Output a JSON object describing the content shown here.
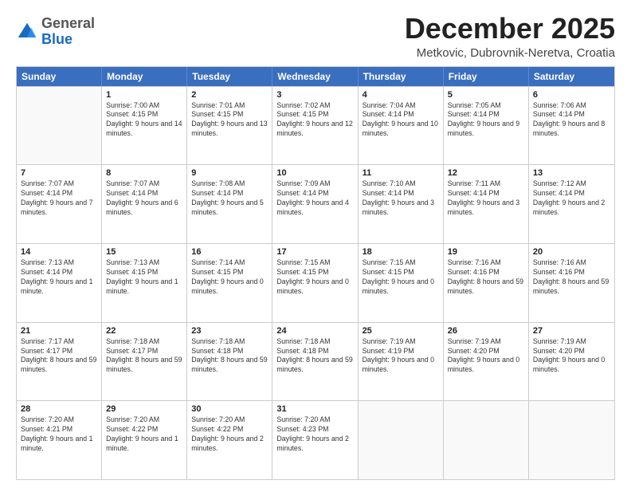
{
  "header": {
    "logo": {
      "general": "General",
      "blue": "Blue"
    },
    "month_title": "December 2025",
    "subtitle": "Metkovic, Dubrovnik-Neretva, Croatia"
  },
  "calendar": {
    "days_of_week": [
      "Sunday",
      "Monday",
      "Tuesday",
      "Wednesday",
      "Thursday",
      "Friday",
      "Saturday"
    ],
    "weeks": [
      [
        {
          "day": "",
          "empty": true
        },
        {
          "day": "1",
          "sunrise": "7:00 AM",
          "sunset": "4:15 PM",
          "daylight": "9 hours and 14 minutes."
        },
        {
          "day": "2",
          "sunrise": "7:01 AM",
          "sunset": "4:15 PM",
          "daylight": "9 hours and 13 minutes."
        },
        {
          "day": "3",
          "sunrise": "7:02 AM",
          "sunset": "4:15 PM",
          "daylight": "9 hours and 12 minutes."
        },
        {
          "day": "4",
          "sunrise": "7:04 AM",
          "sunset": "4:14 PM",
          "daylight": "9 hours and 10 minutes."
        },
        {
          "day": "5",
          "sunrise": "7:05 AM",
          "sunset": "4:14 PM",
          "daylight": "9 hours and 9 minutes."
        },
        {
          "day": "6",
          "sunrise": "7:06 AM",
          "sunset": "4:14 PM",
          "daylight": "9 hours and 8 minutes."
        }
      ],
      [
        {
          "day": "7",
          "sunrise": "7:07 AM",
          "sunset": "4:14 PM",
          "daylight": "9 hours and 7 minutes."
        },
        {
          "day": "8",
          "sunrise": "7:07 AM",
          "sunset": "4:14 PM",
          "daylight": "9 hours and 6 minutes."
        },
        {
          "day": "9",
          "sunrise": "7:08 AM",
          "sunset": "4:14 PM",
          "daylight": "9 hours and 5 minutes."
        },
        {
          "day": "10",
          "sunrise": "7:09 AM",
          "sunset": "4:14 PM",
          "daylight": "9 hours and 4 minutes."
        },
        {
          "day": "11",
          "sunrise": "7:10 AM",
          "sunset": "4:14 PM",
          "daylight": "9 hours and 3 minutes."
        },
        {
          "day": "12",
          "sunrise": "7:11 AM",
          "sunset": "4:14 PM",
          "daylight": "9 hours and 3 minutes."
        },
        {
          "day": "13",
          "sunrise": "7:12 AM",
          "sunset": "4:14 PM",
          "daylight": "9 hours and 2 minutes."
        }
      ],
      [
        {
          "day": "14",
          "sunrise": "7:13 AM",
          "sunset": "4:14 PM",
          "daylight": "9 hours and 1 minute."
        },
        {
          "day": "15",
          "sunrise": "7:13 AM",
          "sunset": "4:15 PM",
          "daylight": "9 hours and 1 minute."
        },
        {
          "day": "16",
          "sunrise": "7:14 AM",
          "sunset": "4:15 PM",
          "daylight": "9 hours and 0 minutes."
        },
        {
          "day": "17",
          "sunrise": "7:15 AM",
          "sunset": "4:15 PM",
          "daylight": "9 hours and 0 minutes."
        },
        {
          "day": "18",
          "sunrise": "7:15 AM",
          "sunset": "4:15 PM",
          "daylight": "9 hours and 0 minutes."
        },
        {
          "day": "19",
          "sunrise": "7:16 AM",
          "sunset": "4:16 PM",
          "daylight": "8 hours and 59 minutes."
        },
        {
          "day": "20",
          "sunrise": "7:16 AM",
          "sunset": "4:16 PM",
          "daylight": "8 hours and 59 minutes."
        }
      ],
      [
        {
          "day": "21",
          "sunrise": "7:17 AM",
          "sunset": "4:17 PM",
          "daylight": "8 hours and 59 minutes."
        },
        {
          "day": "22",
          "sunrise": "7:18 AM",
          "sunset": "4:17 PM",
          "daylight": "8 hours and 59 minutes."
        },
        {
          "day": "23",
          "sunrise": "7:18 AM",
          "sunset": "4:18 PM",
          "daylight": "8 hours and 59 minutes."
        },
        {
          "day": "24",
          "sunrise": "7:18 AM",
          "sunset": "4:18 PM",
          "daylight": "8 hours and 59 minutes."
        },
        {
          "day": "25",
          "sunrise": "7:19 AM",
          "sunset": "4:19 PM",
          "daylight": "9 hours and 0 minutes."
        },
        {
          "day": "26",
          "sunrise": "7:19 AM",
          "sunset": "4:20 PM",
          "daylight": "9 hours and 0 minutes."
        },
        {
          "day": "27",
          "sunrise": "7:19 AM",
          "sunset": "4:20 PM",
          "daylight": "9 hours and 0 minutes."
        }
      ],
      [
        {
          "day": "28",
          "sunrise": "7:20 AM",
          "sunset": "4:21 PM",
          "daylight": "9 hours and 1 minute."
        },
        {
          "day": "29",
          "sunrise": "7:20 AM",
          "sunset": "4:22 PM",
          "daylight": "9 hours and 1 minute."
        },
        {
          "day": "30",
          "sunrise": "7:20 AM",
          "sunset": "4:22 PM",
          "daylight": "9 hours and 2 minutes."
        },
        {
          "day": "31",
          "sunrise": "7:20 AM",
          "sunset": "4:23 PM",
          "daylight": "9 hours and 2 minutes."
        },
        {
          "day": "",
          "empty": true
        },
        {
          "day": "",
          "empty": true
        },
        {
          "day": "",
          "empty": true
        }
      ]
    ]
  }
}
